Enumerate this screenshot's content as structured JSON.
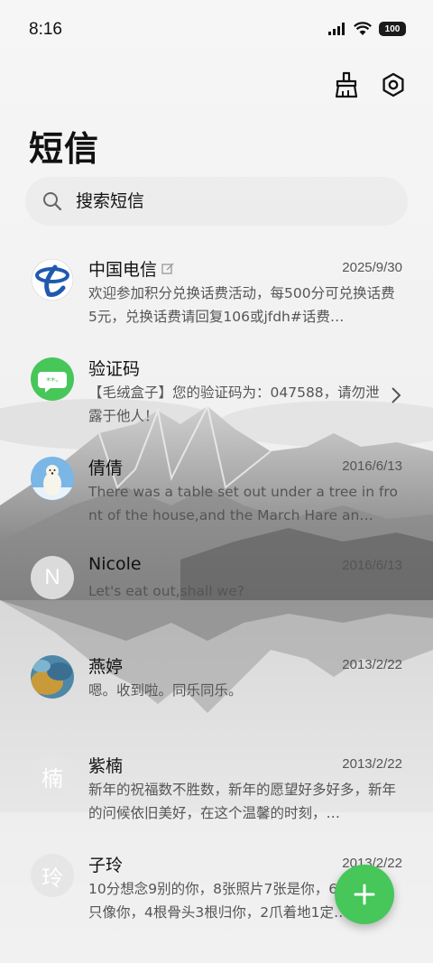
{
  "status": {
    "time": "8:16",
    "battery": "100"
  },
  "header": {
    "title": "短信"
  },
  "search": {
    "placeholder": "搜索短信"
  },
  "conversations": [
    {
      "name": "中国电信",
      "date": "2025/9/30",
      "preview": "欢迎参加积分兑换话费活动，每500分可兑换话费5元，兑换话费请回复106或jfdh#话费…",
      "avatar_icon": "china-telecom-logo"
    },
    {
      "name": "验证码",
      "date": "",
      "preview": "【毛绒盒子】您的验证码为：047588，请勿泄露于他人！",
      "avatar_icon": "message-bubble-icon"
    },
    {
      "name": "倩倩",
      "date": "2016/6/13",
      "preview": "There was a table set out under a tree in front of the house,and the March Hare an…",
      "avatar_icon": "polar-bear-photo"
    },
    {
      "name": "Nicole",
      "date": "2016/6/13",
      "preview": "Let's eat out,shall we?",
      "avatar_letter": "N"
    },
    {
      "name": "燕婷",
      "date": "2013/2/22",
      "preview": "嗯。收到啦。同乐同乐。",
      "avatar_icon": "painted-photo"
    },
    {
      "name": "紫楠",
      "date": "2013/2/22",
      "preview": "新年的祝福数不胜数，新年的愿望好多好多，新年的问候依旧美好，在这个温馨的时刻，…",
      "avatar_letter": "楠"
    },
    {
      "name": "子玲",
      "date": "2013/2/22",
      "preview": "10分想念9别的你，8张照片7张是你，6只小狗5只像你，4根骨头3根归你，2爪着地1定…",
      "avatar_letter": "玲"
    }
  ],
  "colors": {
    "accent": "#47c65a",
    "telecom_blue": "#1f59b0"
  }
}
